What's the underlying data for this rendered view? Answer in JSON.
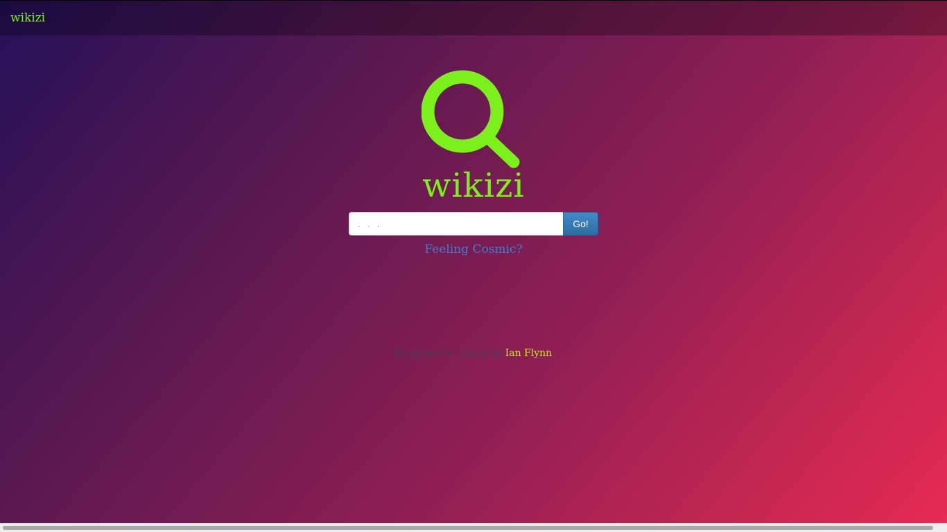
{
  "navbar": {
    "brand": "wikizi"
  },
  "hero": {
    "logo_icon": "search-icon",
    "title": "wikizi"
  },
  "search": {
    "placeholder": ". . .",
    "value": "",
    "button_label": "Go!"
  },
  "random_link": {
    "label": "Feeling Cosmic?"
  },
  "footer": {
    "prefix": "Designed & Coded by ",
    "author": "Ian Flynn"
  },
  "colors": {
    "brand_green": "#7cf01a",
    "button_blue": "#428bca",
    "link_blue": "#3c7fd0",
    "author_yellow": "#c8e71e",
    "gradient_start": "#24105a",
    "gradient_end": "#e82a52"
  },
  "scrollbar": {
    "orientation": "horizontal"
  }
}
